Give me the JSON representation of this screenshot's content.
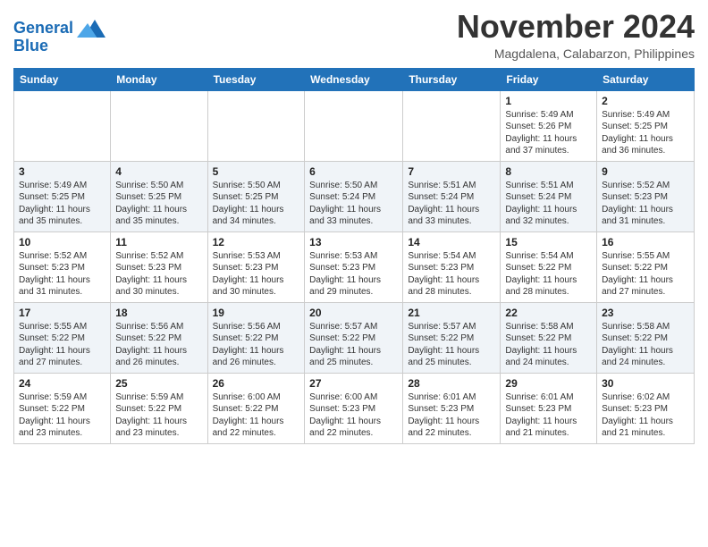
{
  "header": {
    "logo_line1": "General",
    "logo_line2": "Blue",
    "month": "November 2024",
    "location": "Magdalena, Calabarzon, Philippines"
  },
  "weekdays": [
    "Sunday",
    "Monday",
    "Tuesday",
    "Wednesday",
    "Thursday",
    "Friday",
    "Saturday"
  ],
  "weeks": [
    [
      {
        "day": "",
        "info": ""
      },
      {
        "day": "",
        "info": ""
      },
      {
        "day": "",
        "info": ""
      },
      {
        "day": "",
        "info": ""
      },
      {
        "day": "",
        "info": ""
      },
      {
        "day": "1",
        "info": "Sunrise: 5:49 AM\nSunset: 5:26 PM\nDaylight: 11 hours\nand 37 minutes."
      },
      {
        "day": "2",
        "info": "Sunrise: 5:49 AM\nSunset: 5:25 PM\nDaylight: 11 hours\nand 36 minutes."
      }
    ],
    [
      {
        "day": "3",
        "info": "Sunrise: 5:49 AM\nSunset: 5:25 PM\nDaylight: 11 hours\nand 35 minutes."
      },
      {
        "day": "4",
        "info": "Sunrise: 5:50 AM\nSunset: 5:25 PM\nDaylight: 11 hours\nand 35 minutes."
      },
      {
        "day": "5",
        "info": "Sunrise: 5:50 AM\nSunset: 5:25 PM\nDaylight: 11 hours\nand 34 minutes."
      },
      {
        "day": "6",
        "info": "Sunrise: 5:50 AM\nSunset: 5:24 PM\nDaylight: 11 hours\nand 33 minutes."
      },
      {
        "day": "7",
        "info": "Sunrise: 5:51 AM\nSunset: 5:24 PM\nDaylight: 11 hours\nand 33 minutes."
      },
      {
        "day": "8",
        "info": "Sunrise: 5:51 AM\nSunset: 5:24 PM\nDaylight: 11 hours\nand 32 minutes."
      },
      {
        "day": "9",
        "info": "Sunrise: 5:52 AM\nSunset: 5:23 PM\nDaylight: 11 hours\nand 31 minutes."
      }
    ],
    [
      {
        "day": "10",
        "info": "Sunrise: 5:52 AM\nSunset: 5:23 PM\nDaylight: 11 hours\nand 31 minutes."
      },
      {
        "day": "11",
        "info": "Sunrise: 5:52 AM\nSunset: 5:23 PM\nDaylight: 11 hours\nand 30 minutes."
      },
      {
        "day": "12",
        "info": "Sunrise: 5:53 AM\nSunset: 5:23 PM\nDaylight: 11 hours\nand 30 minutes."
      },
      {
        "day": "13",
        "info": "Sunrise: 5:53 AM\nSunset: 5:23 PM\nDaylight: 11 hours\nand 29 minutes."
      },
      {
        "day": "14",
        "info": "Sunrise: 5:54 AM\nSunset: 5:23 PM\nDaylight: 11 hours\nand 28 minutes."
      },
      {
        "day": "15",
        "info": "Sunrise: 5:54 AM\nSunset: 5:22 PM\nDaylight: 11 hours\nand 28 minutes."
      },
      {
        "day": "16",
        "info": "Sunrise: 5:55 AM\nSunset: 5:22 PM\nDaylight: 11 hours\nand 27 minutes."
      }
    ],
    [
      {
        "day": "17",
        "info": "Sunrise: 5:55 AM\nSunset: 5:22 PM\nDaylight: 11 hours\nand 27 minutes."
      },
      {
        "day": "18",
        "info": "Sunrise: 5:56 AM\nSunset: 5:22 PM\nDaylight: 11 hours\nand 26 minutes."
      },
      {
        "day": "19",
        "info": "Sunrise: 5:56 AM\nSunset: 5:22 PM\nDaylight: 11 hours\nand 26 minutes."
      },
      {
        "day": "20",
        "info": "Sunrise: 5:57 AM\nSunset: 5:22 PM\nDaylight: 11 hours\nand 25 minutes."
      },
      {
        "day": "21",
        "info": "Sunrise: 5:57 AM\nSunset: 5:22 PM\nDaylight: 11 hours\nand 25 minutes."
      },
      {
        "day": "22",
        "info": "Sunrise: 5:58 AM\nSunset: 5:22 PM\nDaylight: 11 hours\nand 24 minutes."
      },
      {
        "day": "23",
        "info": "Sunrise: 5:58 AM\nSunset: 5:22 PM\nDaylight: 11 hours\nand 24 minutes."
      }
    ],
    [
      {
        "day": "24",
        "info": "Sunrise: 5:59 AM\nSunset: 5:22 PM\nDaylight: 11 hours\nand 23 minutes."
      },
      {
        "day": "25",
        "info": "Sunrise: 5:59 AM\nSunset: 5:22 PM\nDaylight: 11 hours\nand 23 minutes."
      },
      {
        "day": "26",
        "info": "Sunrise: 6:00 AM\nSunset: 5:22 PM\nDaylight: 11 hours\nand 22 minutes."
      },
      {
        "day": "27",
        "info": "Sunrise: 6:00 AM\nSunset: 5:23 PM\nDaylight: 11 hours\nand 22 minutes."
      },
      {
        "day": "28",
        "info": "Sunrise: 6:01 AM\nSunset: 5:23 PM\nDaylight: 11 hours\nand 22 minutes."
      },
      {
        "day": "29",
        "info": "Sunrise: 6:01 AM\nSunset: 5:23 PM\nDaylight: 11 hours\nand 21 minutes."
      },
      {
        "day": "30",
        "info": "Sunrise: 6:02 AM\nSunset: 5:23 PM\nDaylight: 11 hours\nand 21 minutes."
      }
    ]
  ]
}
